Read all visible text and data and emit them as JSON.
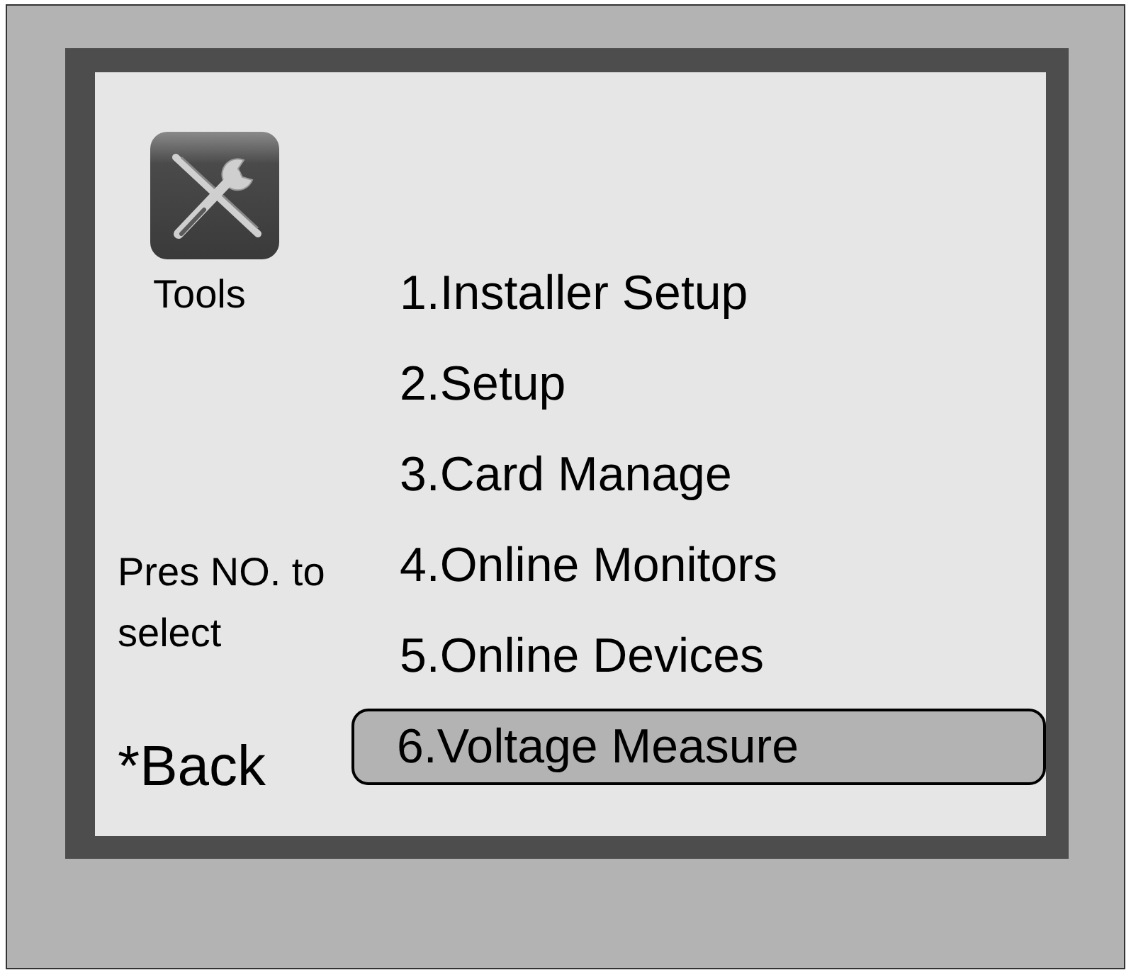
{
  "screen_title": "Tools",
  "hint": "Pres NO. to select",
  "back": "*Back",
  "menu": [
    {
      "label": "1.Installer Setup",
      "selected": false
    },
    {
      "label": "2.Setup",
      "selected": false
    },
    {
      "label": "3.Card Manage",
      "selected": false
    },
    {
      "label": "4.Online Monitors",
      "selected": false
    },
    {
      "label": "5.Online Devices",
      "selected": false
    },
    {
      "label": "6.Voltage Measure",
      "selected": true
    }
  ]
}
